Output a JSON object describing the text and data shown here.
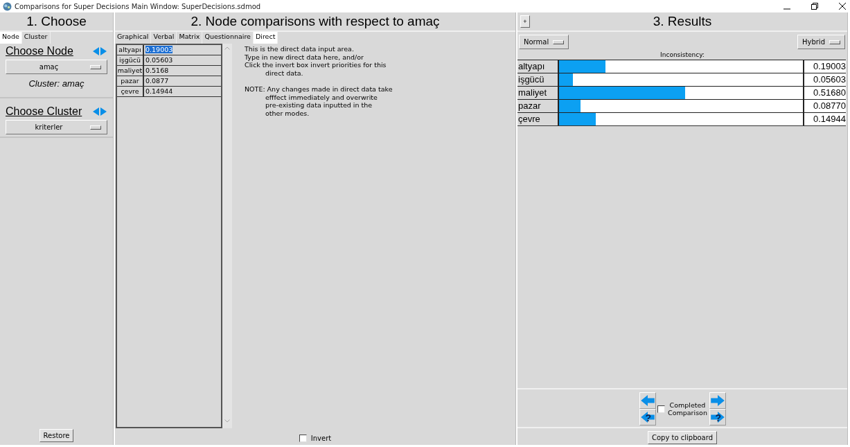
{
  "window": {
    "title": "Comparisons for Super Decisions Main Window: SuperDecisions.sdmod"
  },
  "choose": {
    "heading": "1. Choose",
    "tabs": [
      {
        "label": "Node",
        "selected": true
      },
      {
        "label": "Cluster",
        "selected": false
      }
    ],
    "node_label": "Choose Node",
    "node_value": "amaç",
    "cluster_info": "Cluster: amaç",
    "cluster_label": "Choose Cluster",
    "cluster_value": "kriterler",
    "restore": "Restore"
  },
  "comparisons": {
    "heading": "2. Node comparisons with respect to amaç",
    "tabs": [
      {
        "label": "Graphical",
        "selected": false
      },
      {
        "label": "Verbal",
        "selected": false
      },
      {
        "label": "Matrix",
        "selected": false
      },
      {
        "label": "Questionnaire",
        "selected": false
      },
      {
        "label": "Direct",
        "selected": true
      }
    ],
    "rows": [
      {
        "name": "altyapı",
        "value": "0.19003",
        "selected": true
      },
      {
        "name": "işgücü",
        "value": "0.05603",
        "selected": false
      },
      {
        "name": "maliyet",
        "value": "0.5168",
        "selected": false
      },
      {
        "name": "pazar",
        "value": "0.0877",
        "selected": false
      },
      {
        "name": "çevre",
        "value": "0.14944",
        "selected": false
      }
    ],
    "help": [
      "This is the direct data input area.",
      "Type in new direct data here, and/or",
      "Click the invert box invert priorities for this",
      "direct data.",
      "NOTE: Any changes made in direct data take",
      "efffect immediately and overwrite",
      "pre-existing data inputted in the",
      "other modes."
    ],
    "invert": {
      "label": "Invert",
      "checked": false
    }
  },
  "results": {
    "heading": "3. Results",
    "plus": "+",
    "mode": "Normal",
    "method": "Hybrid",
    "inconsistency": "Inconsistency:",
    "rows": [
      {
        "name": "altyapı",
        "level": 0.19003,
        "reading": "0.19003"
      },
      {
        "name": "işgücü",
        "level": 0.05603,
        "reading": "0.05603"
      },
      {
        "name": "maliyet",
        "level": 0.5168,
        "reading": "0.51680"
      },
      {
        "name": "pazar",
        "level": 0.0877,
        "reading": "0.08770"
      },
      {
        "name": "çevre",
        "level": 0.14944,
        "reading": "0.14944"
      }
    ],
    "nav": [
      {
        "kind": "prev"
      },
      {
        "kind": "next"
      },
      {
        "kind": "prev_help",
        "mark": "?"
      },
      {
        "kind": "next_help",
        "mark": "?"
      }
    ],
    "completed": {
      "label": "Completed Comparison",
      "checked": false
    },
    "copy": "Copy to clipboard"
  }
}
